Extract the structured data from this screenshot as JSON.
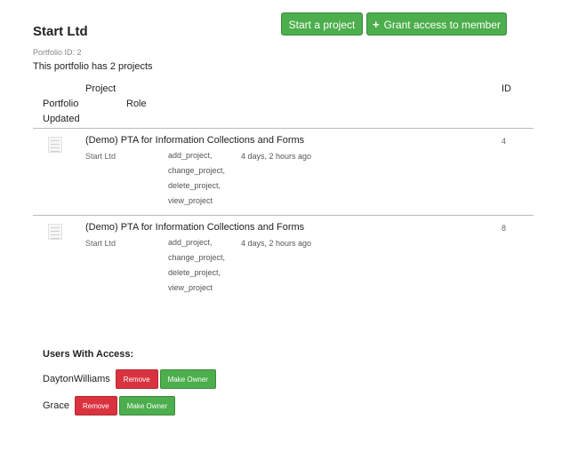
{
  "page": {
    "title": "Start Ltd",
    "portfolio_id_text": "Portfolio ID: 2",
    "project_count_text": "This portfolio has 2 projects"
  },
  "actions": {
    "start_project": "Start a project",
    "grant_access": "Grant access to member"
  },
  "table": {
    "headers": {
      "project": "Project",
      "portfolio": "Portfolio",
      "role": "Role",
      "updated": "Updated",
      "id": "ID"
    },
    "rows": [
      {
        "name": "(Demo) PTA for Information Collections and Forms",
        "portfolio": "Start Ltd",
        "roles": [
          "add_project,",
          "change_project,",
          "delete_project,",
          "view_project"
        ],
        "updated": "4 days, 2 hours ago",
        "id": "4"
      },
      {
        "name": "(Demo) PTA for Information Collections and Forms",
        "portfolio": "Start Ltd",
        "roles": [
          "add_project,",
          "change_project,",
          "delete_project,",
          "view_project"
        ],
        "updated": "4 days, 2 hours ago",
        "id": "8"
      }
    ]
  },
  "users": {
    "title": "Users With Access:",
    "list": [
      {
        "name": "DaytonWilliams",
        "remove": "Remove",
        "make_owner": "Make Owner"
      },
      {
        "name": "Grace",
        "remove": "Remove",
        "make_owner": "Make Owner"
      }
    ]
  }
}
